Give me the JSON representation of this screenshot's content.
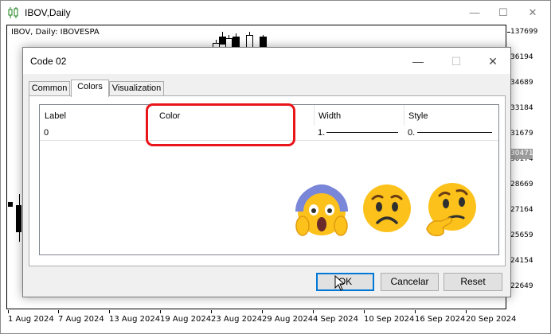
{
  "window": {
    "title": "IBOV,Daily",
    "buttons": {
      "minimize": "—",
      "maximize": "☐",
      "close": "✕"
    }
  },
  "chart": {
    "label": "IBOV, Daily:  IBOVESPA",
    "price_tag": "30471",
    "y_labels": [
      "137699",
      "36194",
      "34689",
      "33184",
      "31679",
      "30174",
      "28669",
      "27164",
      "25659",
      "24154",
      "22649"
    ],
    "x_labels": [
      "1 Aug 2024",
      "7 Aug 2024",
      "13 Aug 2024",
      "19 Aug 2024",
      "23 Aug 2024",
      "29 Aug 2024",
      "4 Sep 2024",
      "10 Sep 2024",
      "16 Sep 2024",
      "20 Sep 2024"
    ]
  },
  "dialog": {
    "title": "Code 02",
    "tabs": [
      "Common",
      "Colors",
      "Visualization"
    ],
    "active_tab": "Colors",
    "columns": [
      "Label",
      "Color",
      "Width",
      "Style"
    ],
    "rows": [
      {
        "label": "0",
        "color": "",
        "width": "1.",
        "style": "0."
      }
    ],
    "buttons": {
      "ok": "OK",
      "cancel": "Cancelar",
      "reset": "Reset"
    }
  },
  "annotation": {
    "highlight_color": "#e8151b",
    "emojis": [
      "face-screaming-in-fear",
      "worried-face",
      "thinking-face"
    ]
  },
  "colors": {
    "accent": "#0078d7",
    "highlight": "#e8151b"
  }
}
